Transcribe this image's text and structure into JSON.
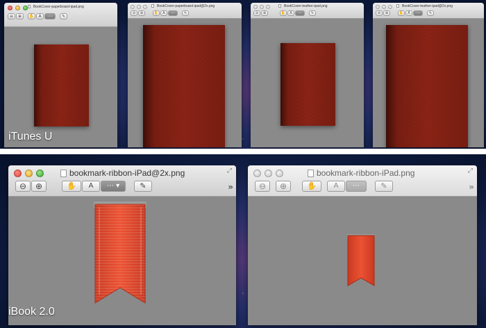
{
  "top_section": {
    "label": "iTunes U",
    "windows": [
      {
        "title": "BookCover-paperboard-ipad.png"
      },
      {
        "title": "BookCover-paperboard-ipad@2x.png"
      },
      {
        "title": "BookCover-leather-ipad.png"
      },
      {
        "title": "BookCover-leather-ipad@2x.png"
      }
    ]
  },
  "bottom_section": {
    "label": "iBook 2.0",
    "windows": [
      {
        "title": "bookmark-ribbon-iPad@2x.png"
      },
      {
        "title": "bookmark-ribbon-iPad.png"
      }
    ]
  },
  "toolbar": {
    "zoom_out": "zoom-out-icon",
    "zoom_in": "zoom-in-icon",
    "hand": "hand-icon",
    "text_select": "text-select-icon",
    "rect_select": "rect-select-icon",
    "annotate": "pencil-icon",
    "more": "chevron-double-right-icon"
  },
  "colors": {
    "book_red": "#8c2416",
    "ribbon_red": "#e5492f",
    "content_grey": "#8a8a8a"
  }
}
